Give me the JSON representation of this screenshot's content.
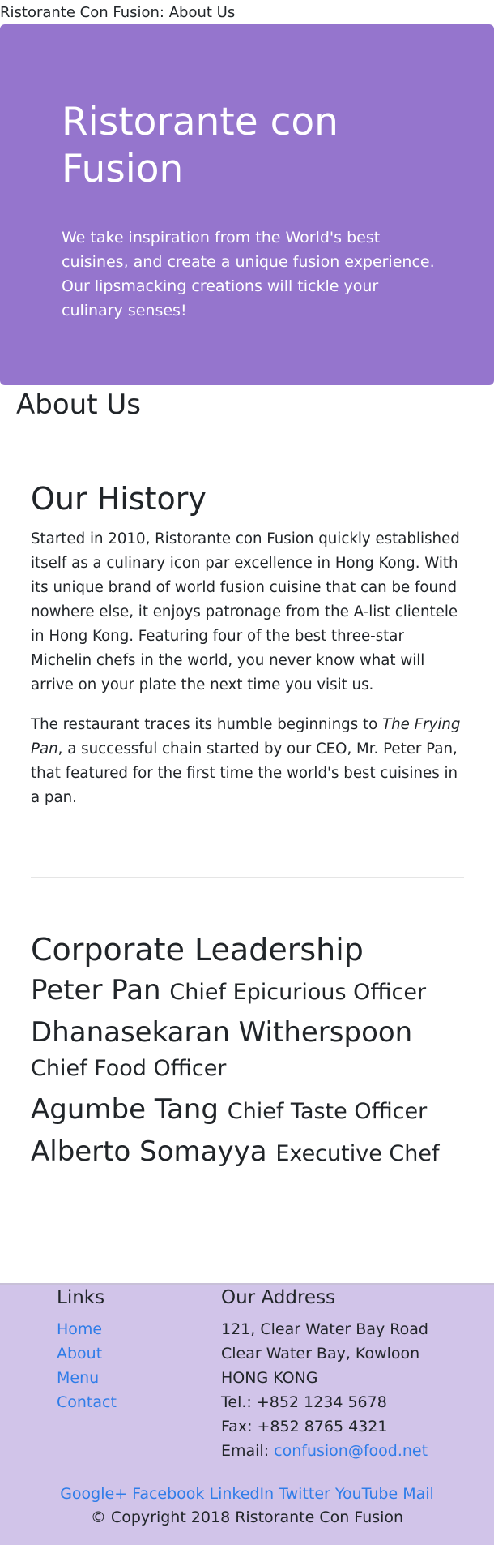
{
  "page": {
    "title": "Ristorante Con Fusion: About Us"
  },
  "jumbotron": {
    "heading": "Ristorante con Fusion",
    "text": "We take inspiration from the World's best cuisines, and create a unique fusion experience. Our lipsmacking creations will tickle your culinary senses!",
    "background": "#9575cd"
  },
  "about": {
    "heading": "About Us"
  },
  "history": {
    "heading": "Our History",
    "paragraph1": "Started in 2010, Ristorante con Fusion quickly established itself as a culinary icon par excellence in Hong Kong. With its unique brand of world fusion cuisine that can be found nowhere else, it enjoys patronage from the A-list clientele in Hong Kong. Featuring four of the best three-star Michelin chefs in the world, you never know what will arrive on your plate the next time you visit us.",
    "paragraph2_prefix": "The restaurant traces its humble beginnings to ",
    "paragraph2_em": "The Frying Pan",
    "paragraph2_suffix": ", a successful chain started by our CEO, Mr. Peter Pan, that featured for the first time the world's best cuisines in a pan."
  },
  "leadership": {
    "heading": "Corporate Leadership",
    "leaders": [
      {
        "name": "Peter Pan",
        "role": "Chief Epicurious Officer"
      },
      {
        "name": "Dhanasekaran Witherspoon",
        "role": "Chief Food Officer"
      },
      {
        "name": "Agumbe Tang",
        "role": "Chief Taste Officer"
      },
      {
        "name": "Alberto Somayya",
        "role": "Executive Chef"
      }
    ]
  },
  "footer": {
    "background": "#d1c4e9",
    "link_color": "#2f7ce8",
    "links_heading": "Links",
    "links": [
      "Home",
      "About",
      "Menu",
      "Contact"
    ],
    "address_heading": "Our Address",
    "address_lines": [
      "121, Clear Water Bay Road",
      "Clear Water Bay, Kowloon",
      "HONG KONG",
      "Tel.: +852 1234 5678",
      "Fax: +852 8765 4321"
    ],
    "email_label": "Email: ",
    "email": "confusion@food.net",
    "social": [
      "Google+",
      "Facebook",
      "LinkedIn",
      "Twitter",
      "YouTube",
      "Mail"
    ],
    "copyright": "© Copyright 2018 Ristorante Con Fusion"
  }
}
